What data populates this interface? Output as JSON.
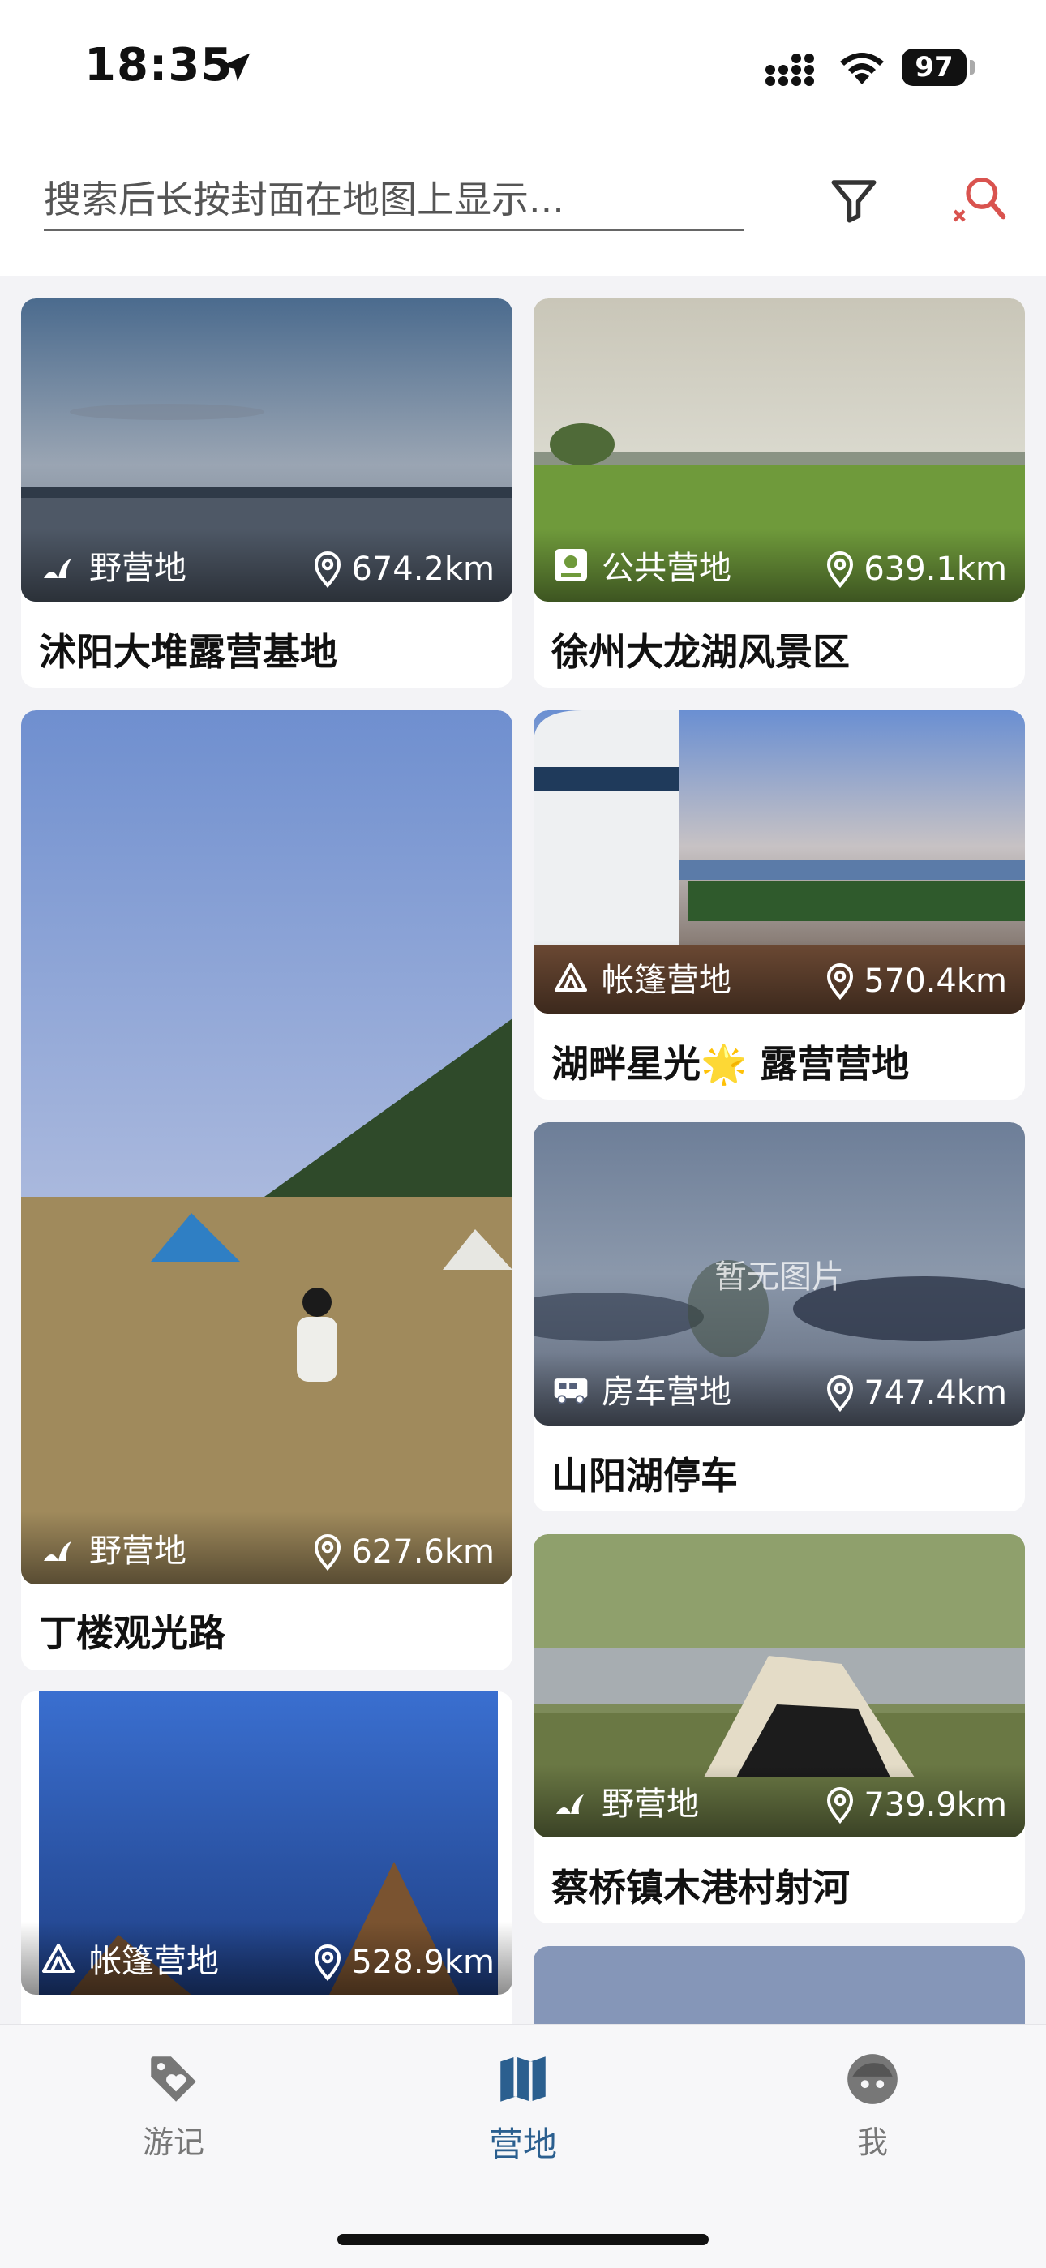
{
  "status_bar": {
    "time": "18:35",
    "battery": "97"
  },
  "search": {
    "placeholder": "搜索后长按封面在地图上显示..."
  },
  "cards": [
    {
      "title": "沭阳大堆露营基地",
      "type": "野营地",
      "distance": "674.2km"
    },
    {
      "title": "徐州大龙湖风景区",
      "type": "公共营地",
      "distance": "639.1km"
    },
    {
      "title": "丁楼观光路",
      "type": "野营地",
      "distance": "627.6km"
    },
    {
      "title": "湖畔星光🌟 露营营地",
      "type": "帐篷营地",
      "distance": "570.4km"
    },
    {
      "title": "山阳湖停车",
      "type": "房车营地",
      "distance": "747.4km",
      "no_image": "暂无图片"
    },
    {
      "title": "蔡桥镇木港村射河",
      "type": "野营地",
      "distance": "739.9km"
    },
    {
      "title": "",
      "type": "帐篷营地",
      "distance": "528.9km"
    }
  ],
  "tabs": [
    {
      "label": "游记",
      "icon": "tag-heart-icon"
    },
    {
      "label": "营地",
      "icon": "map-icon"
    },
    {
      "label": "我",
      "icon": "face-icon"
    }
  ],
  "colors": {
    "accent": "#2b5f8f",
    "search_clear": "#d9534f"
  }
}
